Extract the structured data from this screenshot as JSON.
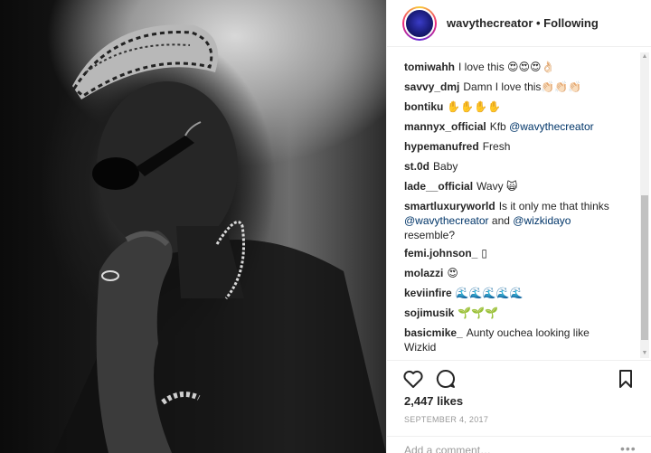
{
  "post": {
    "image_alt": "Black and white portrait photo",
    "author": "wavythecreator",
    "follow_status": "• Following"
  },
  "comments": [
    {
      "user": "tomiwahh",
      "text": "I love this 😍😍😍👌🏻"
    },
    {
      "user": "savvy_dmj",
      "text": "Damn I love this👏🏻👏🏻👏🏻"
    },
    {
      "user": "bontiku",
      "text": "✋✋✋✋"
    },
    {
      "user": "mannyx_official",
      "text": "Kfb ",
      "mention": "@wavythecreator"
    },
    {
      "user": "hypemanufred",
      "text": "Fresh"
    },
    {
      "user": "st.0d",
      "text": "Baby"
    },
    {
      "user": "lade__official",
      "text": "Wavy 🙀"
    },
    {
      "user": "smartluxuryworld",
      "text": "Is it only me that thinks",
      "mention1": "@wavythecreator",
      "middle": " and ",
      "mention2": "@wizkidayo",
      "text2": "resemble?"
    },
    {
      "user": "femi.johnson_",
      "text": "▯"
    },
    {
      "user": "molazzi",
      "text": "😍"
    },
    {
      "user": "keviinfire",
      "text": "🌊🌊🌊🌊🌊"
    },
    {
      "user": "sojimusik",
      "text": "🌱🌱🌱"
    },
    {
      "user": "basicmike_",
      "text": "Aunty ouchea looking like",
      "text2": "Wizkid"
    }
  ],
  "actions": {
    "like_icon": "heart-icon",
    "comment_icon": "comment-bubble-icon",
    "save_icon": "bookmark-icon"
  },
  "likes": "2,447 likes",
  "date": "SEPTEMBER 4, 2017",
  "add_comment": "Add a comment…",
  "more": "•••",
  "colors": {
    "mention": "#003569",
    "text": "#262626",
    "muted": "#999999"
  }
}
